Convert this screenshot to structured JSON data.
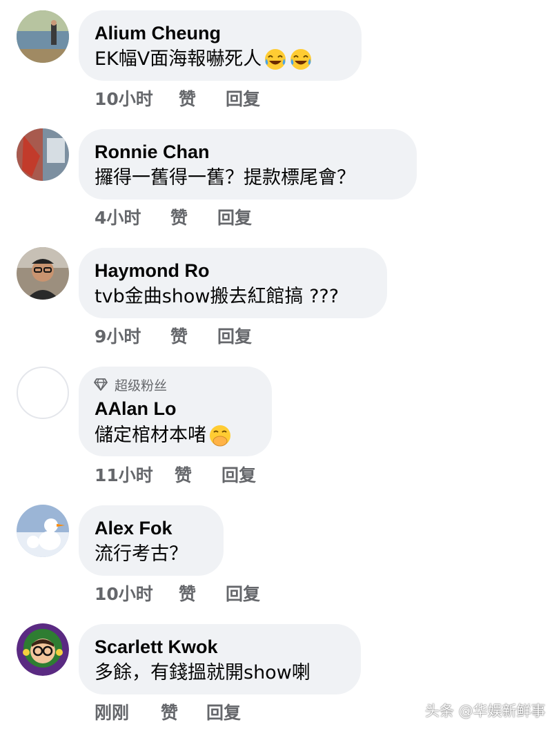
{
  "comments": [
    {
      "author": "Alium Cheung",
      "text": "EK幅V面海報嚇死人",
      "emojis": [
        "laughing-tears-emoji",
        "laughing-tears-emoji"
      ],
      "time": "10小时",
      "like": "赞",
      "reply": "回复"
    },
    {
      "author": "Ronnie Chan",
      "text": "攞得一舊得一舊？提款標尾會？",
      "emojis": [],
      "time": "4小时",
      "like": "赞",
      "reply": "回复"
    },
    {
      "author": "Haymond Ro",
      "text": "tvb金曲show搬去紅館搞 ???",
      "emojis": [],
      "time": "9小时",
      "like": "赞",
      "reply": "回复"
    },
    {
      "badge": "超级粉丝",
      "author": "AAlan Lo",
      "text": "儲定棺材本啫",
      "emojis": [
        "hand-over-mouth-emoji"
      ],
      "time": "11小时",
      "like": "赞",
      "reply": "回复"
    },
    {
      "author": "Alex Fok",
      "text": "流行考古？",
      "emojis": [],
      "time": "10小时",
      "like": "赞",
      "reply": "回复"
    },
    {
      "author": "Scarlett Kwok",
      "text": "多餘，有錢搵就開show喇",
      "emojis": [],
      "time": "刚刚",
      "like": "赞",
      "reply": "回复"
    }
  ],
  "watermark": "头条 @华娱新鲜事",
  "colors": {
    "bubble": "#f0f2f5",
    "meta_text": "#65676b",
    "name_text": "#050505"
  }
}
